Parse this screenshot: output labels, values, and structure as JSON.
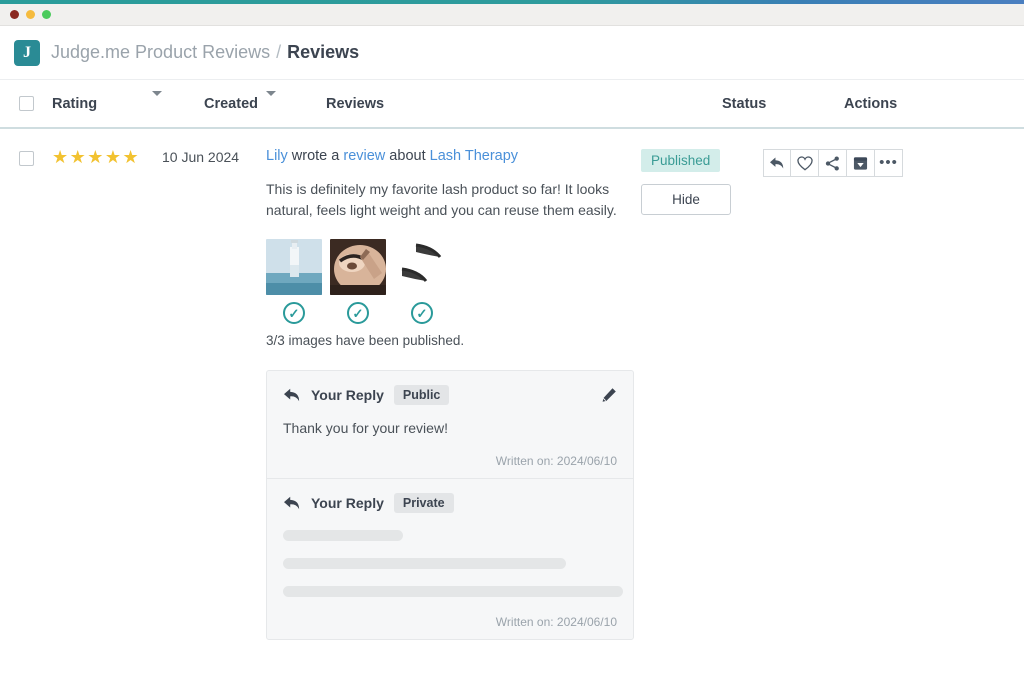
{
  "window": {
    "traffic_lights": [
      "close",
      "minimize",
      "maximize"
    ]
  },
  "header": {
    "logo_letter": "J",
    "app_name": "Judge.me Product Reviews",
    "separator": "/",
    "current_page": "Reviews"
  },
  "table": {
    "columns": {
      "rating": "Rating",
      "created": "Created",
      "reviews": "Reviews",
      "status": "Status",
      "actions": "Actions"
    }
  },
  "review": {
    "stars": "★★★★★",
    "rating_value": 5,
    "date": "10 Jun 2024",
    "author": "Lily",
    "headline_mid1": " wrote a ",
    "headline_link": "review",
    "headline_mid2": " about ",
    "product": "Lash Therapy",
    "body": "This is definitely my favorite lash product so far! It looks natural, feels light weight and you can reuse them easily.",
    "images_note": "3/3 images have been published.",
    "image_count": 3,
    "image_alts": [
      "lash-serum-bottle",
      "applying-lashes",
      "false-lash-pair"
    ],
    "check_glyph": "✓"
  },
  "replies": [
    {
      "label": "Your Reply",
      "visibility": "Public",
      "body": "Thank you for your review!",
      "written_on": "Written on: 2024/06/10",
      "editable": true
    },
    {
      "label": "Your Reply",
      "visibility": "Private",
      "body": "",
      "written_on": "Written on: 2024/06/10",
      "editable": false
    }
  ],
  "status": {
    "badge": "Published",
    "hide_button": "Hide"
  },
  "actions": {
    "icons": [
      "reply-icon",
      "heart-icon",
      "share-icon",
      "archive-icon",
      "more-icon"
    ],
    "more_glyph": "•••"
  },
  "colors": {
    "brand_teal": "#2a8b95",
    "link_blue": "#4a90d9",
    "star_gold": "#f2c230",
    "published_bg": "#d3edea",
    "published_text": "#3a9c95"
  }
}
